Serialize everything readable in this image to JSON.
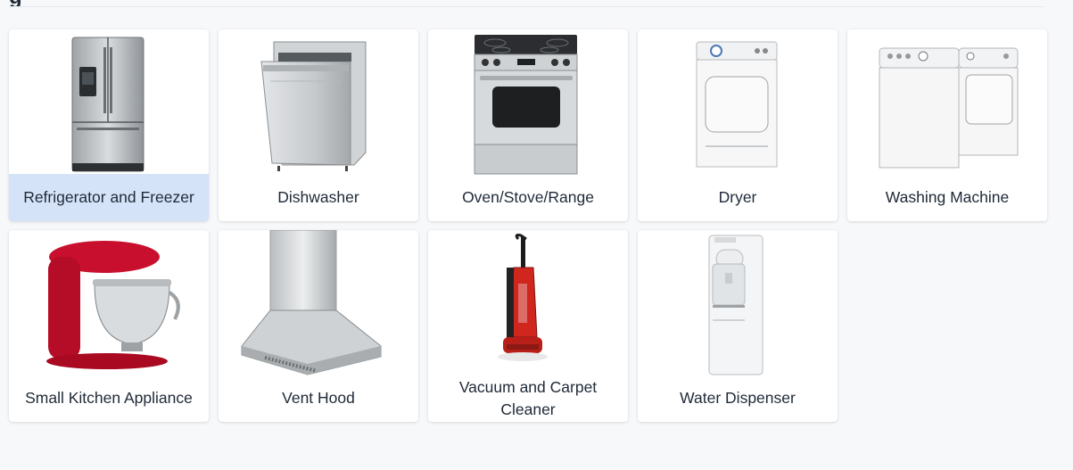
{
  "page": {
    "heading_fragment": "g"
  },
  "categories": [
    {
      "label": "Refrigerator and Freezer",
      "icon": "refrigerator-icon",
      "selected": true
    },
    {
      "label": "Dishwasher",
      "icon": "dishwasher-icon",
      "selected": false
    },
    {
      "label": "Oven/Stove/Range",
      "icon": "oven-icon",
      "selected": false
    },
    {
      "label": "Dryer",
      "icon": "dryer-icon",
      "selected": false
    },
    {
      "label": "Washing Machine",
      "icon": "washing-machine-icon",
      "selected": false
    },
    {
      "label": "Small Kitchen Appliance",
      "icon": "stand-mixer-icon",
      "selected": false
    },
    {
      "label": "Vent Hood",
      "icon": "vent-hood-icon",
      "selected": false
    },
    {
      "label": "Vacuum and Carpet Cleaner",
      "icon": "vacuum-icon",
      "selected": false
    },
    {
      "label": "Water Dispenser",
      "icon": "water-dispenser-icon",
      "selected": false
    }
  ],
  "colors": {
    "selected_label_bg": "#d5e3f9",
    "mixer_red": "#c8102e",
    "vacuum_red": "#d0261e",
    "steel": "#c7cacd"
  }
}
